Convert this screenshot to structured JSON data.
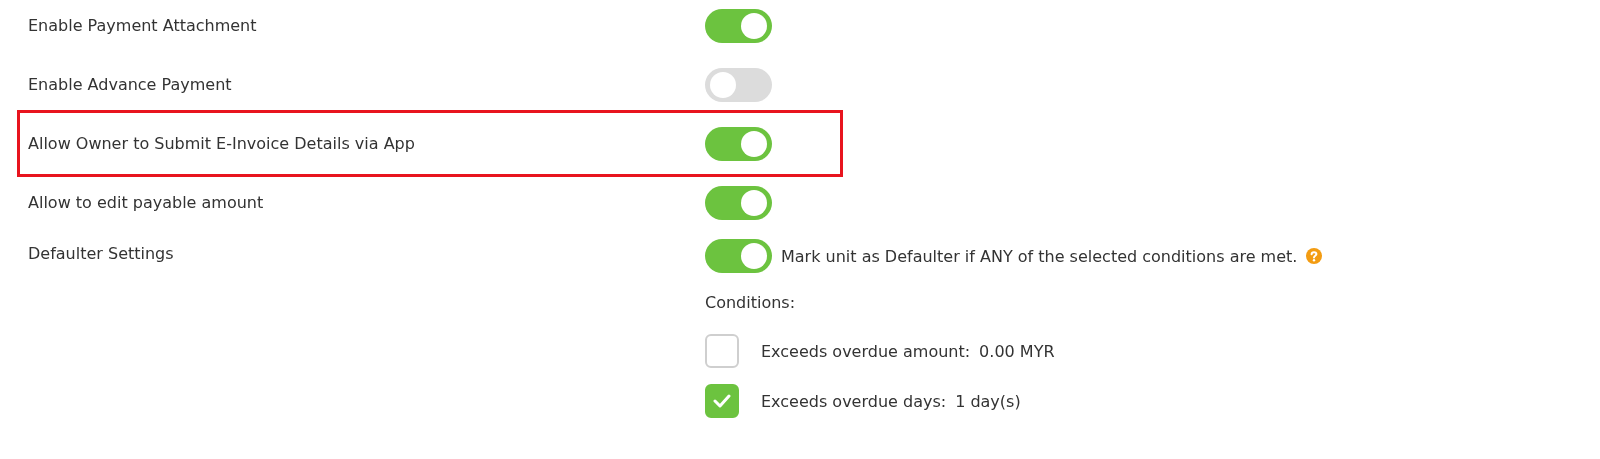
{
  "settings": [
    {
      "label": "Enable Payment Attachment",
      "on": true,
      "highlighted": false
    },
    {
      "label": "Enable Advance Payment",
      "on": false,
      "highlighted": false
    },
    {
      "label": "Allow Owner to Submit E-Invoice Details via App",
      "on": true,
      "highlighted": true
    },
    {
      "label": "Allow to edit payable amount",
      "on": true,
      "highlighted": false
    }
  ],
  "defaulter": {
    "label": "Defaulter Settings",
    "on": true,
    "description": "Mark unit as Defaulter if ANY of the selected conditions are met.",
    "conditions_label": "Conditions:",
    "conditions": [
      {
        "label": "Exceeds overdue amount:",
        "value": "0.00 MYR",
        "checked": false
      },
      {
        "label": "Exceeds overdue days:",
        "value": "1 day(s)",
        "checked": true
      }
    ]
  }
}
